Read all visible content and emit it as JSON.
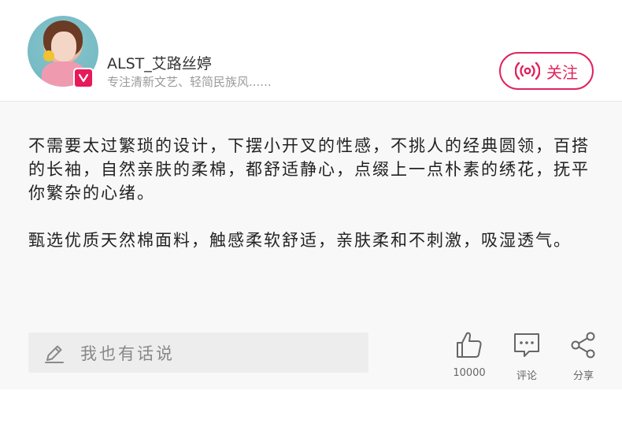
{
  "profile": {
    "username": "ALST_艾路丝婷",
    "subtitle": "专注清新文艺、轻简民族风......",
    "badge_letter": "v"
  },
  "follow_button": {
    "label": "关注",
    "icon": "broadcast-icon"
  },
  "post": {
    "paragraphs": [
      "不需要太过繁琐的设计，下摆小开叉的性感，不挑人的经典圆领，百搭的长袖，自然亲肤的柔棉，都舒适静心，点缀上一点朴素的绣花，抚平你繁杂的心绪。",
      "甄选优质天然棉面料，触感柔软舒适，亲肤柔和不刺激，吸湿透气。"
    ]
  },
  "comment_input": {
    "placeholder": "我也有话说",
    "icon": "pencil-icon"
  },
  "actions": {
    "like": {
      "label": "10000",
      "icon": "thumbs-up-icon"
    },
    "comment": {
      "label": "评论",
      "icon": "comment-icon"
    },
    "share": {
      "label": "分享",
      "icon": "share-icon"
    }
  },
  "colors": {
    "accent": "#e0245e",
    "badge": "#e8195a",
    "content_bg": "#f8f8f8",
    "input_bg": "#ededed"
  }
}
